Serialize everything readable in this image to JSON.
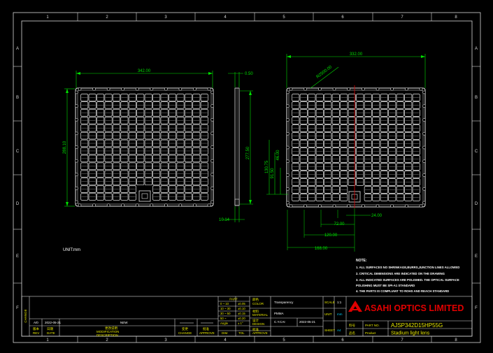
{
  "colors": {
    "background": "#000000",
    "frame": "#d8d8d8",
    "lens": "#e6e6e6",
    "dim": "#00e000",
    "title_block": "#d8d8d8",
    "yellow": "#e8e800",
    "red": "#e00000",
    "label": "#ffffff"
  },
  "border": {
    "columns_top": [
      "1",
      "2",
      "3",
      "4",
      "5",
      "6",
      "7",
      "8"
    ],
    "columns_bottom": [
      "1",
      "2",
      "3",
      "4",
      "5",
      "6",
      "7",
      "8"
    ],
    "rows_left": [
      "A",
      "B",
      "C",
      "D",
      "E",
      "F"
    ],
    "rows_right": [
      "A",
      "B",
      "C",
      "D",
      "E",
      "F"
    ]
  },
  "dimensions": {
    "front_width": "342.00",
    "front_height": "288.10",
    "side_thickness": "0.50",
    "side_height": "277.50",
    "side_base": "10.14",
    "right_width": "332.00",
    "right_diag": "R2500.00",
    "right_v1": "130.75",
    "right_v2": "91.50",
    "right_v3": "46.00",
    "right_h1": "24.00",
    "right_h2": "72.00",
    "right_h3": "120.00",
    "right_h4": "168.00"
  },
  "unit_label": "UNIT:mm",
  "notes": {
    "heading": "NOTE:",
    "items": [
      "1. ALL SURFACES NO SHRINKAGE,BURRS,JUNCTION LINES ALLOWED",
      "2. CRITICAL DIMENSIONS ARE INDICATED ON THE DRAWING",
      "3. ALL INDICATED SURFACES ARE POLISHED. THE OPTICAL SURFACE",
      "   POLISHING MUST BE SPI-A1 STANDARD",
      "4. THE PARTS IS COMPLIANT TO ROHS AND REACH STANDARD"
    ]
  },
  "title_block": {
    "change_label": "CHANGE",
    "rev_row": {
      "rev": "A/0",
      "date": "2022-05-21",
      "desc": "NEW"
    },
    "headers": {
      "rev_cn": "版本",
      "rev_en": "REV",
      "date_cn": "日期",
      "date_en": "DATE",
      "desc_cn": "更改说明",
      "desc_en1": "MODIFICATION",
      "desc_en2": "DESCRIPTION",
      "change_cn": "变更",
      "change_en": "CHANGE",
      "approve_cn": "批准",
      "approve_en": "APPROVE"
    },
    "tolerance": {
      "title": "PART",
      "rows": [
        [
          "0 ~ 10",
          "±0.05"
        ],
        [
          "10 ~ 30",
          "±0.10"
        ],
        [
          "30 ~ 50",
          "±0.15"
        ],
        [
          "50 ~",
          "±0.20"
        ],
        [
          "Angle",
          "± 1°"
        ]
      ],
      "footer_l": "DIM.",
      "footer_r": "TOL"
    },
    "fields": {
      "color_cn": "颜色",
      "color_en": "COLOR",
      "color_val": "Transparency",
      "material_cn": "材料",
      "material_en": "MATERIAL",
      "material_val": "PMMA",
      "design_cn": "设计",
      "design_en": "DESIGN",
      "design_val": "C.Y.CAI",
      "design_date": "2022-05-21",
      "approve_cn": "批准",
      "approve_en": "APPROVE",
      "scale_label": "SCALE",
      "scale_val": "1:1",
      "unit_label": "UNIT",
      "unit_val": "mm",
      "sheet_label": "SHEET",
      "sheet_val": "A4"
    },
    "company": "ASAHI OPTICS LIMITED",
    "part_no_cn": "料号",
    "part_no_en": "PART NO.",
    "part_no_val": "AJSP342D15HP55G",
    "product_cn": "品名",
    "product_en": "Product",
    "product_val": "Stadium light lens"
  }
}
